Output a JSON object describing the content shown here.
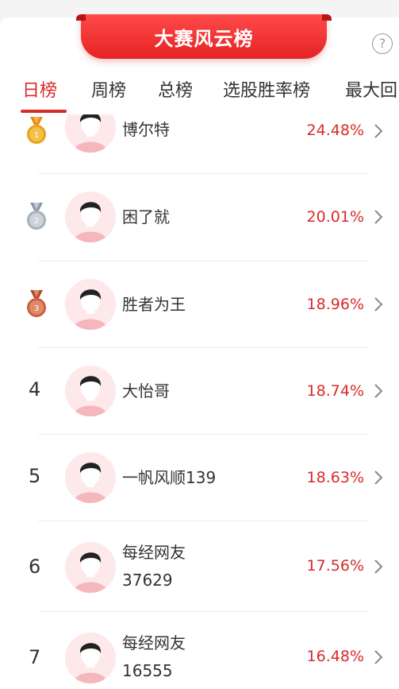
{
  "header": {
    "title": "大赛风云榜"
  },
  "tabs": [
    {
      "label": "日榜"
    },
    {
      "label": "周榜"
    },
    {
      "label": "总榜"
    },
    {
      "label": "选股胜率榜"
    },
    {
      "label": "最大回"
    }
  ],
  "rows": [
    {
      "rank": "1",
      "name": "博尔特",
      "name2": "",
      "pct": "24.48%"
    },
    {
      "rank": "2",
      "name": "困了就",
      "name2": "",
      "pct": "20.01%"
    },
    {
      "rank": "3",
      "name": "胜者为王",
      "name2": "",
      "pct": "18.96%"
    },
    {
      "rank": "4",
      "name": "大怡哥",
      "name2": "",
      "pct": "18.74%"
    },
    {
      "rank": "5",
      "name": "一帆风顺139",
      "name2": "",
      "pct": "18.63%"
    },
    {
      "rank": "6",
      "name": "每经网友",
      "name2": "37629",
      "pct": "17.56%"
    },
    {
      "rank": "7",
      "name": "每经网友",
      "name2": "16555",
      "pct": "16.48%"
    }
  ],
  "colors": {
    "accent": "#d92a2a",
    "gold": "#e7a21a",
    "silver": "#a7b0bb",
    "bronze": "#c8613f"
  },
  "icons": [
    "help-icon",
    "gold-medal-icon",
    "silver-medal-icon",
    "bronze-medal-icon",
    "chevron-right-icon",
    "avatar-icon"
  ]
}
